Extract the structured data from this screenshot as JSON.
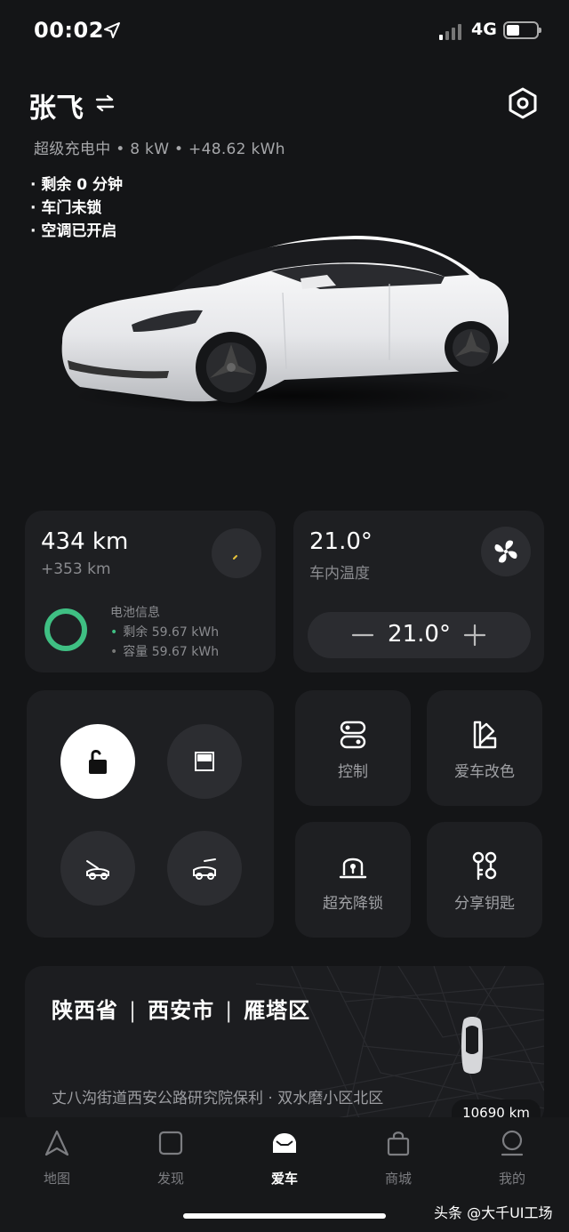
{
  "status_bar": {
    "time": "00:02",
    "network": "4G",
    "location_icon": "location-arrow-icon",
    "signal_icon": "signal-bars-icon",
    "battery_icon": "battery-icon"
  },
  "header": {
    "car_name": "张飞",
    "swap_icon": "swap-icon",
    "settings_icon": "hexagon-settings-icon",
    "charge_line": "超级充电中 • 8 kW • +48.62 kWh",
    "notes": [
      "· 剩余 0 分钟",
      "· 车门未锁",
      "· 空调已开启"
    ]
  },
  "range": {
    "value": "434 km",
    "delta": "+353 km"
  },
  "battery": {
    "title": "电池信息",
    "remaining": "剩余 59.67 kWh",
    "capacity": "容量 59.67 kWh",
    "ring_color": "#3fbf83"
  },
  "climate": {
    "value": "21.0°",
    "label": "车内温度",
    "setpoint": "21.0°",
    "fan_icon": "fan-icon"
  },
  "controls": {
    "lock_icon": "unlock-icon",
    "window_icon": "car-window-icon",
    "frunk_icon": "frunk-icon",
    "trunk_icon": "trunk-icon"
  },
  "tiles": {
    "control": "控制",
    "paint": "爱车改色",
    "supercharger_lock": "超充降锁",
    "share_key": "分享钥匙"
  },
  "location": {
    "province": "陕西省",
    "city": "西安市",
    "district": "雁塔区",
    "separator": "|",
    "address": "丈八沟街道西安公路研究院保利 · 双水磨小区北区",
    "distance": "10690 km"
  },
  "tabbar": {
    "items": [
      {
        "label": "地图",
        "icon": "map-arrow-icon"
      },
      {
        "label": "发现",
        "icon": "discover-square-icon"
      },
      {
        "label": "爱车",
        "icon": "car-front-icon"
      },
      {
        "label": "商城",
        "icon": "shopping-bag-icon"
      },
      {
        "label": "我的",
        "icon": "profile-icon"
      }
    ],
    "active": "爱车"
  },
  "watermark": "头条 @大千UI工场"
}
